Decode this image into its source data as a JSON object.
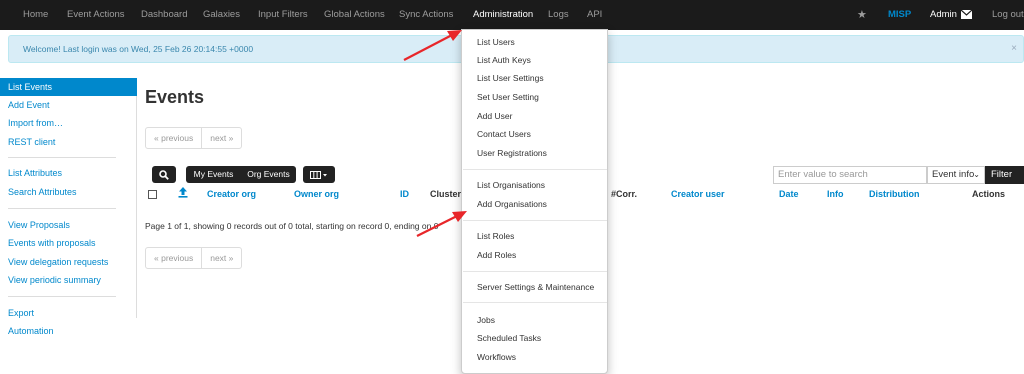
{
  "navbar": {
    "items": [
      "Home",
      "Event Actions",
      "Dashboard",
      "Galaxies",
      "Input Filters",
      "Global Actions",
      "Sync Actions",
      "Administration",
      "Logs",
      "API"
    ],
    "brand": "MISP",
    "user": "Admin",
    "logout": "Log out"
  },
  "alert": {
    "text": "Welcome! Last login was on Wed, 25 Feb 26 20:14:55 +0000",
    "close": "×"
  },
  "sidebar": {
    "items": [
      "List Events",
      "Add Event",
      "Import from…",
      "REST client",
      "List Attributes",
      "Search Attributes",
      "View Proposals",
      "Events with proposals",
      "View delegation requests",
      "View periodic summary",
      "Export",
      "Automation"
    ]
  },
  "main": {
    "title": "Events",
    "pager": {
      "previous": "« previous",
      "next": "next »"
    },
    "filters": {
      "my_events": "My Events",
      "org_events": "Org Events"
    },
    "search_placeholder": "Enter value to search",
    "select_value": "Event info",
    "filter_label": "Filter",
    "columns": [
      "Creator org",
      "Owner org",
      "ID",
      "Clusters",
      "#Corr.",
      "Creator user",
      "Date",
      "Info",
      "Distribution",
      "Actions"
    ],
    "status": "Page 1 of 1, showing 0 records out of 0 total, starting on record 0, ending on 0"
  },
  "admin_menu": {
    "groups": [
      [
        "List Users",
        "List Auth Keys",
        "List User Settings",
        "Set User Setting",
        "Add User",
        "Contact Users",
        "User Registrations"
      ],
      [
        "List Organisations",
        "Add Organisations"
      ],
      [
        "List Roles",
        "Add Roles"
      ],
      [
        "Server Settings & Maintenance"
      ],
      [
        "Jobs",
        "Scheduled Tasks",
        "Workflows"
      ]
    ]
  },
  "colors": {
    "navbar_bg": "#1b1b1b",
    "link": "#0088cc",
    "alert_bg": "#d9edf7",
    "annotation_arrow": "#e8262a"
  }
}
